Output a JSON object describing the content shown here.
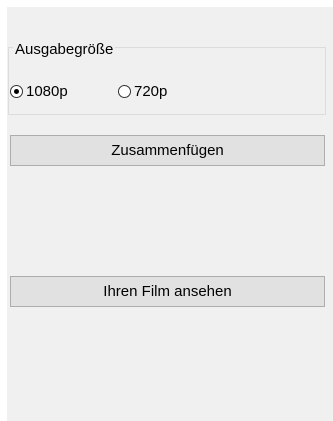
{
  "output_group": {
    "label": "Ausgabegröße",
    "options": [
      {
        "label": "1080p",
        "selected": true
      },
      {
        "label": "720p",
        "selected": false
      }
    ]
  },
  "buttons": {
    "merge": "Zusammenfügen",
    "watch": "Ihren Film ansehen"
  }
}
